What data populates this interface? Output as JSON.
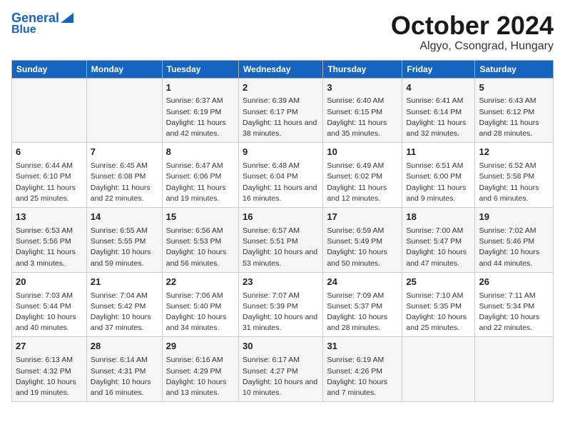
{
  "header": {
    "logo_line1": "General",
    "logo_line2": "Blue",
    "month_title": "October 2024",
    "location": "Algyo, Csongrad, Hungary"
  },
  "weekdays": [
    "Sunday",
    "Monday",
    "Tuesday",
    "Wednesday",
    "Thursday",
    "Friday",
    "Saturday"
  ],
  "weeks": [
    [
      {
        "day": "",
        "content": ""
      },
      {
        "day": "",
        "content": ""
      },
      {
        "day": "1",
        "content": "Sunrise: 6:37 AM\nSunset: 6:19 PM\nDaylight: 11 hours and 42 minutes."
      },
      {
        "day": "2",
        "content": "Sunrise: 6:39 AM\nSunset: 6:17 PM\nDaylight: 11 hours and 38 minutes."
      },
      {
        "day": "3",
        "content": "Sunrise: 6:40 AM\nSunset: 6:15 PM\nDaylight: 11 hours and 35 minutes."
      },
      {
        "day": "4",
        "content": "Sunrise: 6:41 AM\nSunset: 6:14 PM\nDaylight: 11 hours and 32 minutes."
      },
      {
        "day": "5",
        "content": "Sunrise: 6:43 AM\nSunset: 6:12 PM\nDaylight: 11 hours and 28 minutes."
      }
    ],
    [
      {
        "day": "6",
        "content": "Sunrise: 6:44 AM\nSunset: 6:10 PM\nDaylight: 11 hours and 25 minutes."
      },
      {
        "day": "7",
        "content": "Sunrise: 6:45 AM\nSunset: 6:08 PM\nDaylight: 11 hours and 22 minutes."
      },
      {
        "day": "8",
        "content": "Sunrise: 6:47 AM\nSunset: 6:06 PM\nDaylight: 11 hours and 19 minutes."
      },
      {
        "day": "9",
        "content": "Sunrise: 6:48 AM\nSunset: 6:04 PM\nDaylight: 11 hours and 16 minutes."
      },
      {
        "day": "10",
        "content": "Sunrise: 6:49 AM\nSunset: 6:02 PM\nDaylight: 11 hours and 12 minutes."
      },
      {
        "day": "11",
        "content": "Sunrise: 6:51 AM\nSunset: 6:00 PM\nDaylight: 11 hours and 9 minutes."
      },
      {
        "day": "12",
        "content": "Sunrise: 6:52 AM\nSunset: 5:58 PM\nDaylight: 11 hours and 6 minutes."
      }
    ],
    [
      {
        "day": "13",
        "content": "Sunrise: 6:53 AM\nSunset: 5:56 PM\nDaylight: 11 hours and 3 minutes."
      },
      {
        "day": "14",
        "content": "Sunrise: 6:55 AM\nSunset: 5:55 PM\nDaylight: 10 hours and 59 minutes."
      },
      {
        "day": "15",
        "content": "Sunrise: 6:56 AM\nSunset: 5:53 PM\nDaylight: 10 hours and 56 minutes."
      },
      {
        "day": "16",
        "content": "Sunrise: 6:57 AM\nSunset: 5:51 PM\nDaylight: 10 hours and 53 minutes."
      },
      {
        "day": "17",
        "content": "Sunrise: 6:59 AM\nSunset: 5:49 PM\nDaylight: 10 hours and 50 minutes."
      },
      {
        "day": "18",
        "content": "Sunrise: 7:00 AM\nSunset: 5:47 PM\nDaylight: 10 hours and 47 minutes."
      },
      {
        "day": "19",
        "content": "Sunrise: 7:02 AM\nSunset: 5:46 PM\nDaylight: 10 hours and 44 minutes."
      }
    ],
    [
      {
        "day": "20",
        "content": "Sunrise: 7:03 AM\nSunset: 5:44 PM\nDaylight: 10 hours and 40 minutes."
      },
      {
        "day": "21",
        "content": "Sunrise: 7:04 AM\nSunset: 5:42 PM\nDaylight: 10 hours and 37 minutes."
      },
      {
        "day": "22",
        "content": "Sunrise: 7:06 AM\nSunset: 5:40 PM\nDaylight: 10 hours and 34 minutes."
      },
      {
        "day": "23",
        "content": "Sunrise: 7:07 AM\nSunset: 5:39 PM\nDaylight: 10 hours and 31 minutes."
      },
      {
        "day": "24",
        "content": "Sunrise: 7:09 AM\nSunset: 5:37 PM\nDaylight: 10 hours and 28 minutes."
      },
      {
        "day": "25",
        "content": "Sunrise: 7:10 AM\nSunset: 5:35 PM\nDaylight: 10 hours and 25 minutes."
      },
      {
        "day": "26",
        "content": "Sunrise: 7:11 AM\nSunset: 5:34 PM\nDaylight: 10 hours and 22 minutes."
      }
    ],
    [
      {
        "day": "27",
        "content": "Sunrise: 6:13 AM\nSunset: 4:32 PM\nDaylight: 10 hours and 19 minutes."
      },
      {
        "day": "28",
        "content": "Sunrise: 6:14 AM\nSunset: 4:31 PM\nDaylight: 10 hours and 16 minutes."
      },
      {
        "day": "29",
        "content": "Sunrise: 6:16 AM\nSunset: 4:29 PM\nDaylight: 10 hours and 13 minutes."
      },
      {
        "day": "30",
        "content": "Sunrise: 6:17 AM\nSunset: 4:27 PM\nDaylight: 10 hours and 10 minutes."
      },
      {
        "day": "31",
        "content": "Sunrise: 6:19 AM\nSunset: 4:26 PM\nDaylight: 10 hours and 7 minutes."
      },
      {
        "day": "",
        "content": ""
      },
      {
        "day": "",
        "content": ""
      }
    ]
  ]
}
